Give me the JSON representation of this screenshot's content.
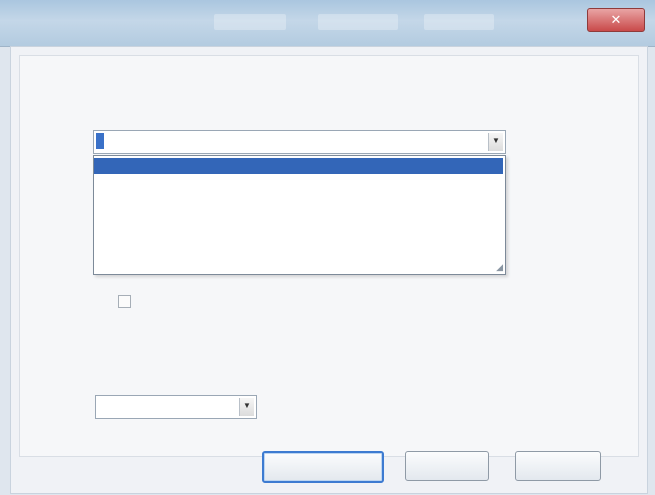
{
  "window": {
    "title": "",
    "close_glyph": "✕"
  },
  "section1": {
    "heading": "",
    "group_label": ""
  },
  "combo1": {
    "value": "",
    "arrow": "▼"
  },
  "dropdown": {
    "options": [
      "",
      "",
      "",
      "",
      "",
      ""
    ],
    "selected_index": 0
  },
  "checkbox": {
    "label": "",
    "checked": false
  },
  "section2": {
    "heading": ""
  },
  "combo2": {
    "value": "",
    "arrow": "▼"
  },
  "buttons": {
    "primary": "",
    "secondary": "",
    "tertiary": ""
  },
  "colors": {
    "accent": "#3366b8",
    "close": "#c94a4a"
  }
}
